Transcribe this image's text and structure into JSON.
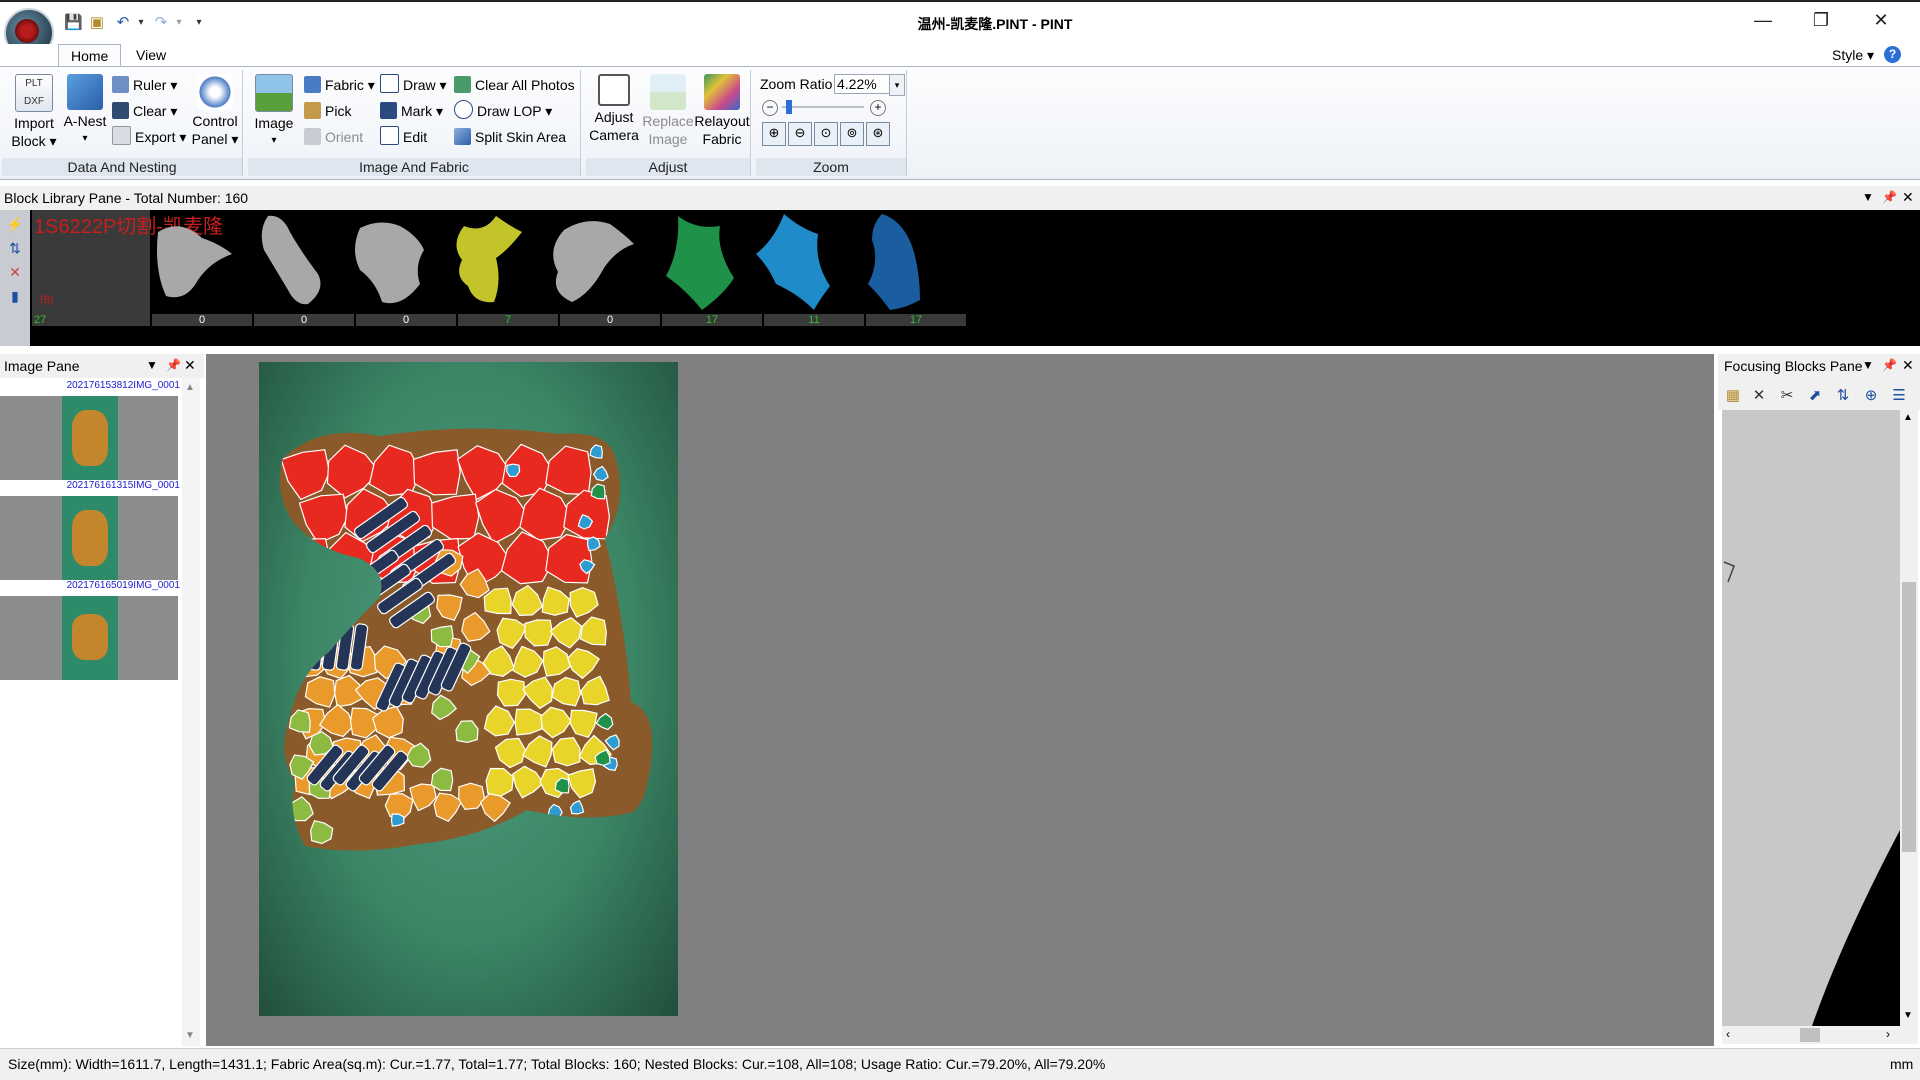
{
  "window": {
    "title": "温州-凯麦隆.PINT - PINT",
    "minimize": "—",
    "restore": "❐",
    "close": "✕"
  },
  "quick_access": {
    "save": "💾",
    "undo": "↶",
    "redo": "↷",
    "more": "▾"
  },
  "tabs": {
    "home": "Home",
    "view": "View",
    "style": "Style ▾"
  },
  "ribbon": {
    "data_and_nesting": {
      "label": "Data And Nesting",
      "import_block": "Import Block ▾",
      "a_nest": "A-Nest",
      "ruler": "Ruler ▾",
      "clear": "Clear ▾",
      "export": "Export ▾",
      "control_panel": "Control Panel ▾"
    },
    "image_and_fabric": {
      "label": "Image And Fabric",
      "image": "Image",
      "fabric": "Fabric ▾",
      "pick": "Pick",
      "orient": "Orient",
      "draw": "Draw ▾",
      "mark": "Mark ▾",
      "edit": "Edit",
      "clear_all_photos": "Clear All Photos",
      "draw_lop": "Draw LOP ▾",
      "split_skin_area": "Split Skin Area"
    },
    "adjust": {
      "label": "Adjust",
      "adjust_camera": "Adjust Camera",
      "replace_image": "Replace Image",
      "relayout_fabric": "Relayout Fabric"
    },
    "zoom": {
      "label": "Zoom",
      "zoom_ratio_label": "Zoom Ratio",
      "zoom_ratio_value": "4.22%",
      "level": 0.05
    }
  },
  "block_library": {
    "header": "Block Library Pane - Total Number: 160",
    "group_label": "1S6222P切割-凯麦隆",
    "group_sub": "(8)",
    "group_count": "27",
    "blocks": [
      {
        "count": "0",
        "color": "#a8a8a8"
      },
      {
        "count": "0",
        "color": "#a8a8a8"
      },
      {
        "count": "0",
        "color": "#a8a8a8"
      },
      {
        "count": "7",
        "color": "#c3c32a"
      },
      {
        "count": "0",
        "color": "#a8a8a8"
      },
      {
        "count": "17",
        "color": "#1f9148"
      },
      {
        "count": "11",
        "color": "#1f8bc8"
      },
      {
        "count": "17",
        "color": "#1a5ea0"
      }
    ]
  },
  "image_pane": {
    "header": "Image Pane",
    "images": [
      {
        "name": "202176153812IMG_0001"
      },
      {
        "name": "202176161315IMG_0001"
      },
      {
        "name": "202176165019IMG_0001"
      }
    ]
  },
  "focusing_pane": {
    "header": "Focusing Blocks Pane"
  },
  "status": {
    "text": "Size(mm): Width=1611.7, Length=1431.1; Fabric Area(sq.m): Cur.=1.77, Total=1.77; Total Blocks: 160; Nested Blocks: Cur.=108, All=108; Usage Ratio: Cur.=79.20%, All=79.20%",
    "unit": "mm"
  },
  "colors": {
    "red": "#e8291f",
    "orange": "#e99a2a",
    "yellow": "#e9d52a",
    "light_green": "#8dbb42",
    "navy": "#243558",
    "blue": "#2e9bd1",
    "green": "#1f9148",
    "leather": "#8a5a2a"
  }
}
